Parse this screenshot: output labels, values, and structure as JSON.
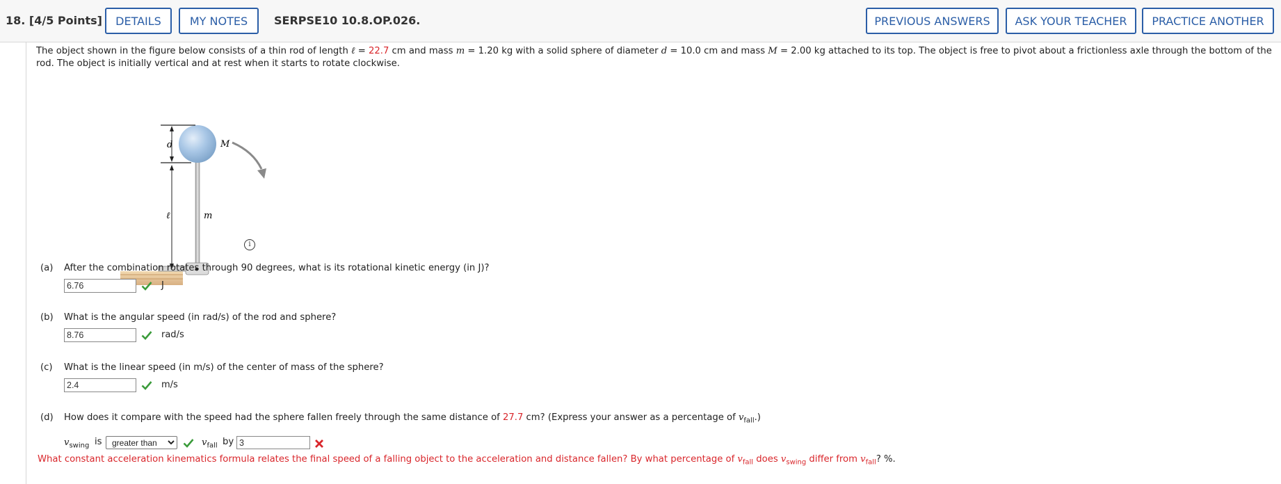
{
  "header": {
    "question_number": "18. [4/5 Points]",
    "details_label": "DETAILS",
    "my_notes_label": "MY NOTES",
    "problem_code": "SERPSE10 10.8.OP.026.",
    "previous_answers_label": "PREVIOUS ANSWERS",
    "ask_teacher_label": "ASK YOUR TEACHER",
    "practice_another_label": "PRACTICE ANOTHER"
  },
  "intro": {
    "part1": "The object shown in the figure below consists of a thin rod of length ",
    "ell": "ℓ",
    "eq1": " = ",
    "length_value": "22.7",
    "part2": " cm and mass ",
    "m": "m",
    "part3": " = 1.20 kg with a solid sphere of diameter ",
    "d": "d",
    "part4": " = 10.0 cm and mass ",
    "M": "M",
    "part5": " = 2.00 kg attached to its top. The object is free to pivot about a frictionless axle through the bottom of the rod. The object is initially vertical and at rest when it starts to rotate clockwise."
  },
  "figure": {
    "label_d": "d",
    "label_M": "M",
    "label_ell": "ℓ",
    "label_m": "m",
    "info_icon": "i"
  },
  "parts": {
    "a": {
      "label": "(a)",
      "question": "After the combination rotates through 90 degrees, what is its rotational kinetic energy (in J)?",
      "answer": "6.76",
      "unit": "J",
      "status": "correct"
    },
    "b": {
      "label": "(b)",
      "question": "What is the angular speed (in rad/s) of the rod and sphere?",
      "answer": "8.76",
      "unit": "rad/s",
      "status": "correct"
    },
    "c": {
      "label": "(c)",
      "question": "What is the linear speed (in m/s) of the center of mass of the sphere?",
      "answer": "2.4",
      "unit": "m/s",
      "status": "correct"
    },
    "d": {
      "label": "(d)",
      "q1": "How does it compare with the speed had the sphere fallen freely through the same distance of ",
      "distance": "27.7",
      "q2": " cm? (Express your answer as a percentage of ",
      "v": "v",
      "fall_sub": "fall",
      "q3": ".)",
      "swing_sub": "swing",
      "is_text": "is",
      "select_value": "greater than",
      "select_status": "correct",
      "by_text": "by",
      "answer": "3",
      "answer_status": "incorrect",
      "hint1": "What constant acceleration kinematics formula relates the final speed of a falling object to the acceleration and distance fallen? By what percentage of ",
      "hint2": " does ",
      "hint3": " differ from ",
      "hint4": "? %."
    }
  },
  "colors": {
    "accent": "#2b5ea7",
    "correct": "#3a9b3a",
    "incorrect": "#d9262b",
    "sphere": "#9ec0e2"
  }
}
